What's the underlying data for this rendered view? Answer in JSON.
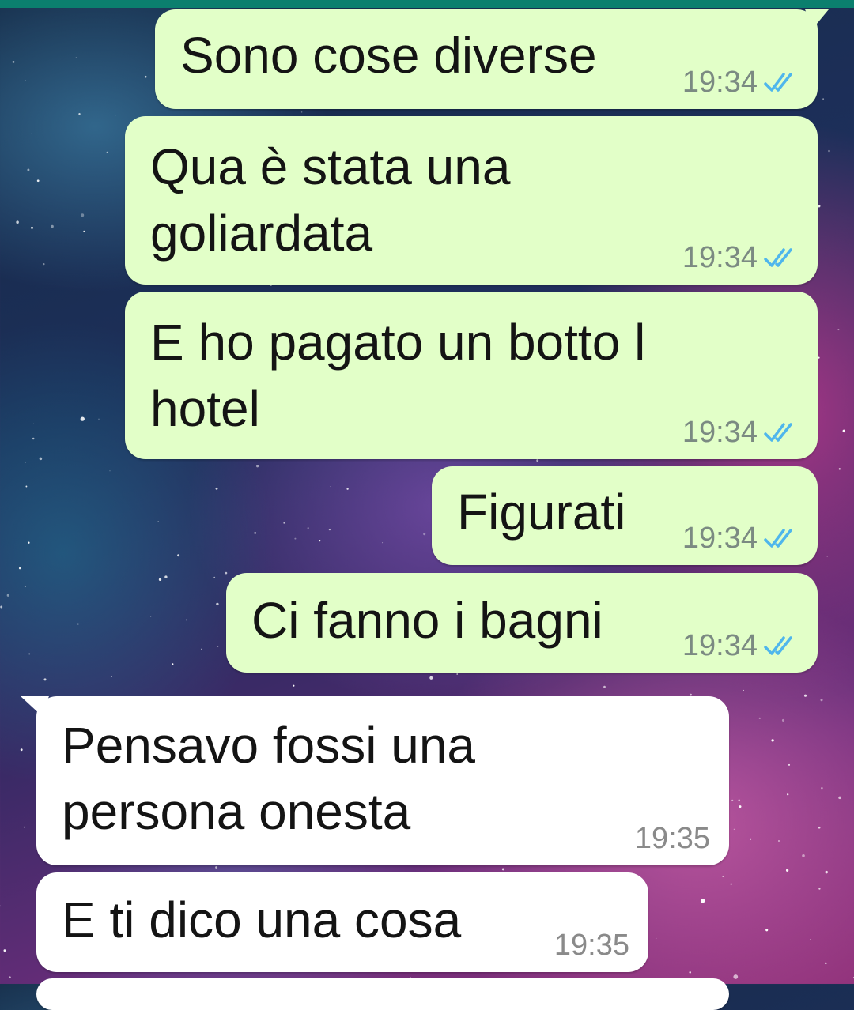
{
  "chat": {
    "messages": [
      {
        "direction": "out",
        "text_lines": [
          "Sono cose diverse"
        ],
        "time": "19:34",
        "status": "double-check-read-icon",
        "status_color": "#4fb6ec"
      },
      {
        "direction": "out",
        "text_lines": [
          "Qua è stata una",
          "goliardata"
        ],
        "time": "19:34",
        "status": "double-check-read-icon",
        "status_color": "#4fb6ec"
      },
      {
        "direction": "out",
        "text_lines": [
          "E ho pagato un botto l",
          "hotel"
        ],
        "time": "19:34",
        "status": "double-check-read-icon",
        "status_color": "#4fb6ec"
      },
      {
        "direction": "out",
        "text_lines": [
          "Figurati"
        ],
        "time": "19:34",
        "status": "double-check-read-icon",
        "status_color": "#4fb6ec"
      },
      {
        "direction": "out",
        "text_lines": [
          "Ci fanno i bagni"
        ],
        "time": "19:34",
        "status": "double-check-read-icon",
        "status_color": "#4fb6ec"
      },
      {
        "direction": "in",
        "text_lines": [
          "Pensavo fossi una",
          "persona onesta"
        ],
        "time": "19:35"
      },
      {
        "direction": "in",
        "text_lines": [
          "E ti dico una cosa"
        ],
        "time": "19:35"
      }
    ]
  },
  "colors": {
    "outgoing_bubble": "#e2ffc8",
    "incoming_bubble": "#ffffff",
    "header_accent": "#0b7f6e"
  }
}
